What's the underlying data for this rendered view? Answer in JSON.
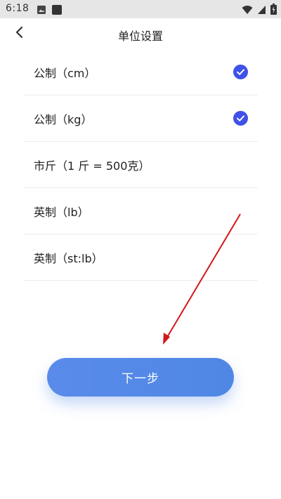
{
  "status_bar": {
    "time": "6:18",
    "icons": [
      "image-icon",
      "notification-icon",
      "wifi-icon",
      "signal-icon",
      "battery-icon"
    ]
  },
  "header": {
    "title": "单位设置",
    "back_icon": "chevron-left-icon"
  },
  "options": [
    {
      "label": "公制（cm）",
      "checked": true
    },
    {
      "label": "公制（kg）",
      "checked": true
    },
    {
      "label": "市斤（1 斤 = 500克）",
      "checked": false
    },
    {
      "label": "英制（lb）",
      "checked": false
    },
    {
      "label": "英制（st:lb）",
      "checked": false
    }
  ],
  "next_button": {
    "label": "下一步"
  },
  "colors": {
    "accent": "#3f51e8",
    "button": "#5a8bea",
    "annotation_arrow": "#d0171b"
  }
}
